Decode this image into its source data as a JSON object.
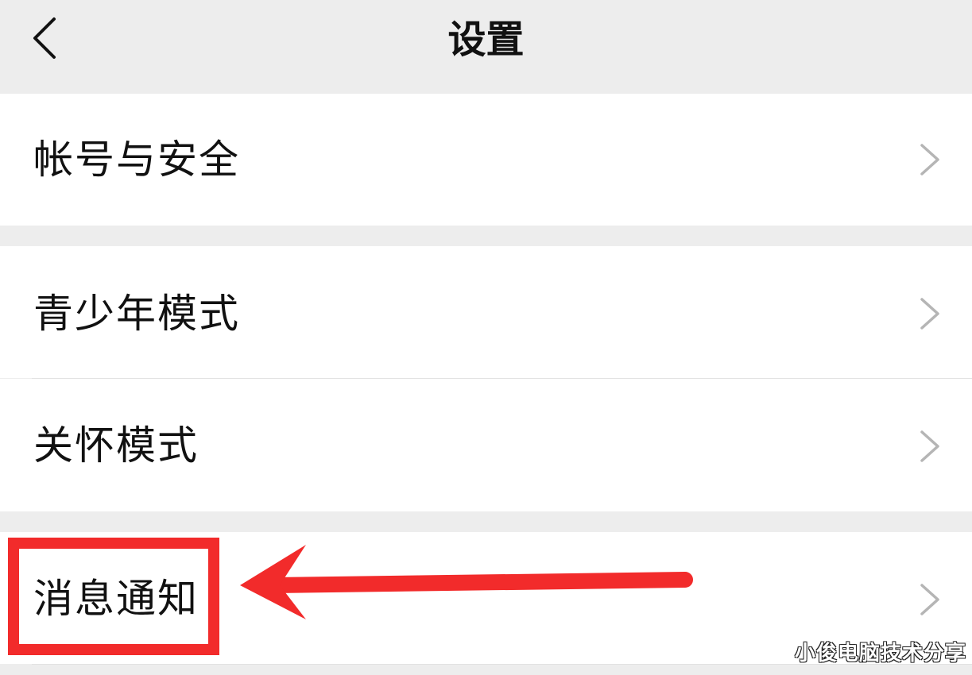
{
  "header": {
    "back_icon": "chevron-left-icon",
    "title": "设置"
  },
  "settings": {
    "account_security": "帐号与安全",
    "teen_mode": "青少年模式",
    "care_mode": "关怀模式",
    "message_notifications": "消息通知"
  },
  "icons": {
    "row_chevron": "chevron-right-icon"
  },
  "annotation": {
    "highlight_color": "#f22b2b"
  },
  "watermark": "小俊电脑技术分享"
}
